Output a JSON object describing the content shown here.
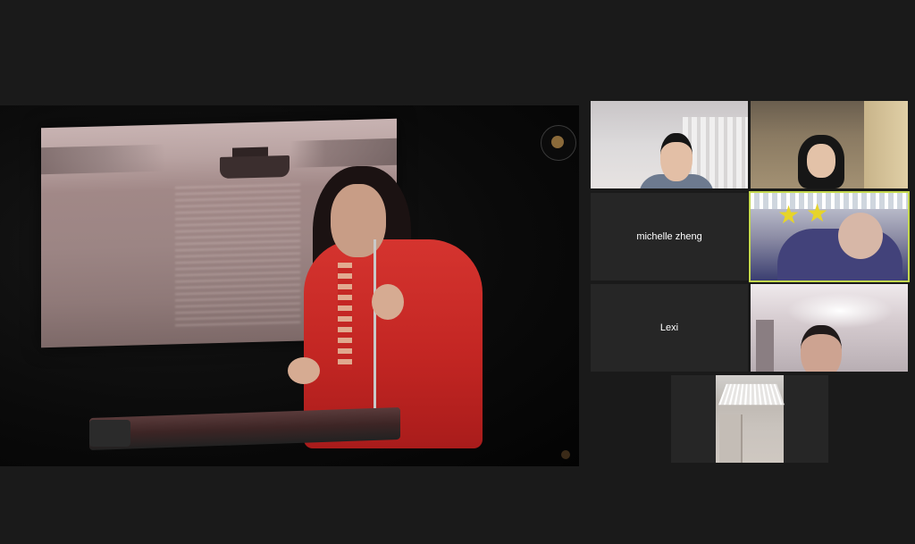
{
  "meeting": {
    "shared_video": {
      "logo_icon": "round-logo-badge",
      "corner_icon": "small-watermark-badge"
    },
    "participants": [
      {
        "name": "",
        "video_on": true,
        "active_speaker": false
      },
      {
        "name": "",
        "video_on": true,
        "active_speaker": false
      },
      {
        "name": "michelle zheng",
        "video_on": false,
        "active_speaker": false
      },
      {
        "name": "",
        "video_on": true,
        "active_speaker": true
      },
      {
        "name": "Lexi",
        "video_on": false,
        "active_speaker": false
      },
      {
        "name": "",
        "video_on": true,
        "active_speaker": false
      },
      {
        "name": "",
        "video_on": true,
        "active_speaker": false
      }
    ],
    "colors": {
      "background": "#1a1a1a",
      "tile_bg": "#262626",
      "active_speaker_border": "#c4d84f",
      "name_text": "#ffffff"
    }
  }
}
